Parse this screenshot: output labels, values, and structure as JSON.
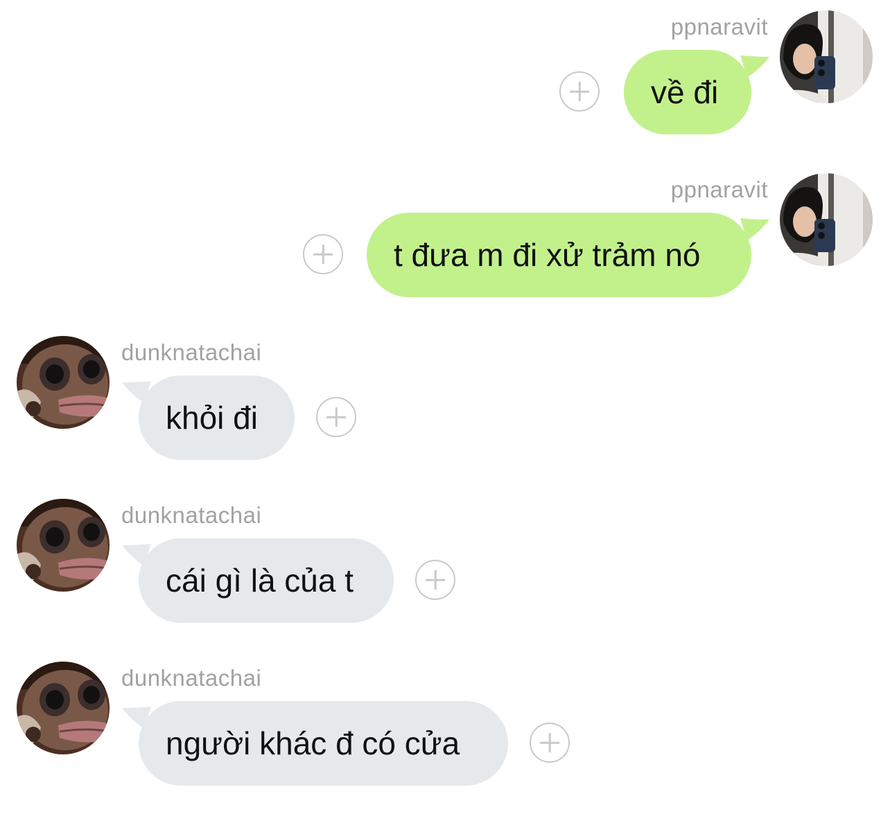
{
  "messages": [
    {
      "direction": "outgoing",
      "sender": "ppnaravit",
      "text": "về đi"
    },
    {
      "direction": "outgoing",
      "sender": "ppnaravit",
      "text": "t đưa m đi xử trảm nó"
    },
    {
      "direction": "incoming",
      "sender": "dunknatachai",
      "text": "khỏi đi"
    },
    {
      "direction": "incoming",
      "sender": "dunknatachai",
      "text": "cái gì là của t"
    },
    {
      "direction": "incoming",
      "sender": "dunknatachai",
      "text": "người khác đ có cửa"
    }
  ],
  "colors": {
    "outgoing_bubble": "#c2f18c",
    "incoming_bubble": "#e6e9ec",
    "sender_name": "#a2a2a2",
    "reaction_icon": "#c9c9c9"
  },
  "icons": {
    "reaction": "add-reaction-icon",
    "outgoing_avatar": "mirror-selfie-avatar",
    "incoming_avatar": "frog-meme-avatar"
  }
}
